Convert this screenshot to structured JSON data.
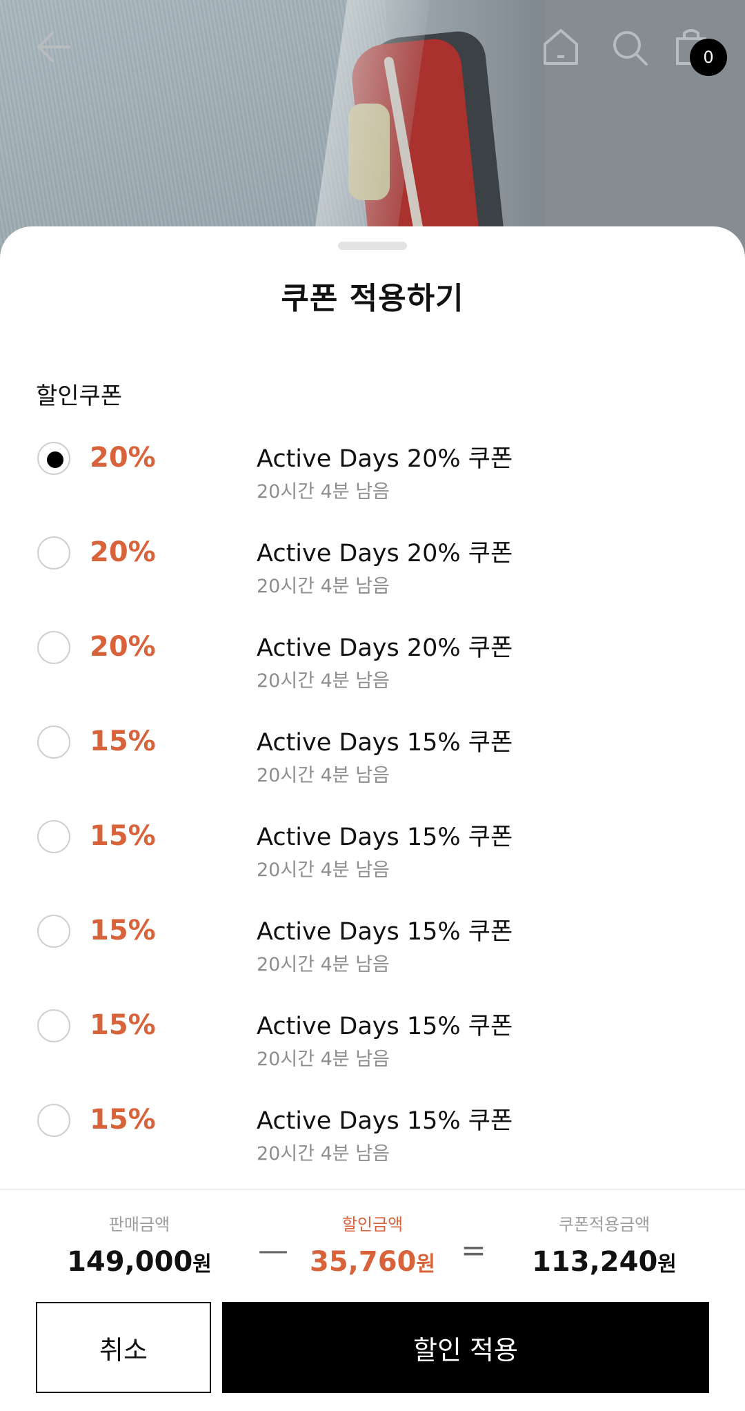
{
  "header": {
    "cart_count": "0"
  },
  "sheet": {
    "title": "쿠폰 적용하기",
    "section_label": "할인쿠폰",
    "coupons": [
      {
        "percent": "20%",
        "name": "Active Days 20% 쿠폰",
        "time_left": "20시간 4분 남음",
        "selected": true
      },
      {
        "percent": "20%",
        "name": "Active Days 20% 쿠폰",
        "time_left": "20시간 4분 남음",
        "selected": false
      },
      {
        "percent": "20%",
        "name": "Active Days 20% 쿠폰",
        "time_left": "20시간 4분 남음",
        "selected": false
      },
      {
        "percent": "15%",
        "name": "Active Days 15% 쿠폰",
        "time_left": "20시간 4분 남음",
        "selected": false
      },
      {
        "percent": "15%",
        "name": "Active Days 15% 쿠폰",
        "time_left": "20시간 4분 남음",
        "selected": false
      },
      {
        "percent": "15%",
        "name": "Active Days 15% 쿠폰",
        "time_left": "20시간 4분 남음",
        "selected": false
      },
      {
        "percent": "15%",
        "name": "Active Days 15% 쿠폰",
        "time_left": "20시간 4분 남음",
        "selected": false
      },
      {
        "percent": "15%",
        "name": "Active Days 15% 쿠폰",
        "time_left": "20시간 4분 남음",
        "selected": false
      }
    ]
  },
  "summary": {
    "sale_label": "판매금액",
    "sale_amount": "149,000",
    "discount_label": "할인금액",
    "discount_amount": "35,760",
    "final_label": "쿠폰적용금액",
    "final_amount": "113,240",
    "currency": "원",
    "minus": "—",
    "equals": "="
  },
  "actions": {
    "cancel_label": "취소",
    "apply_label": "할인 적용"
  },
  "colors": {
    "accent": "#d8623a",
    "primary_button": "#000000"
  }
}
